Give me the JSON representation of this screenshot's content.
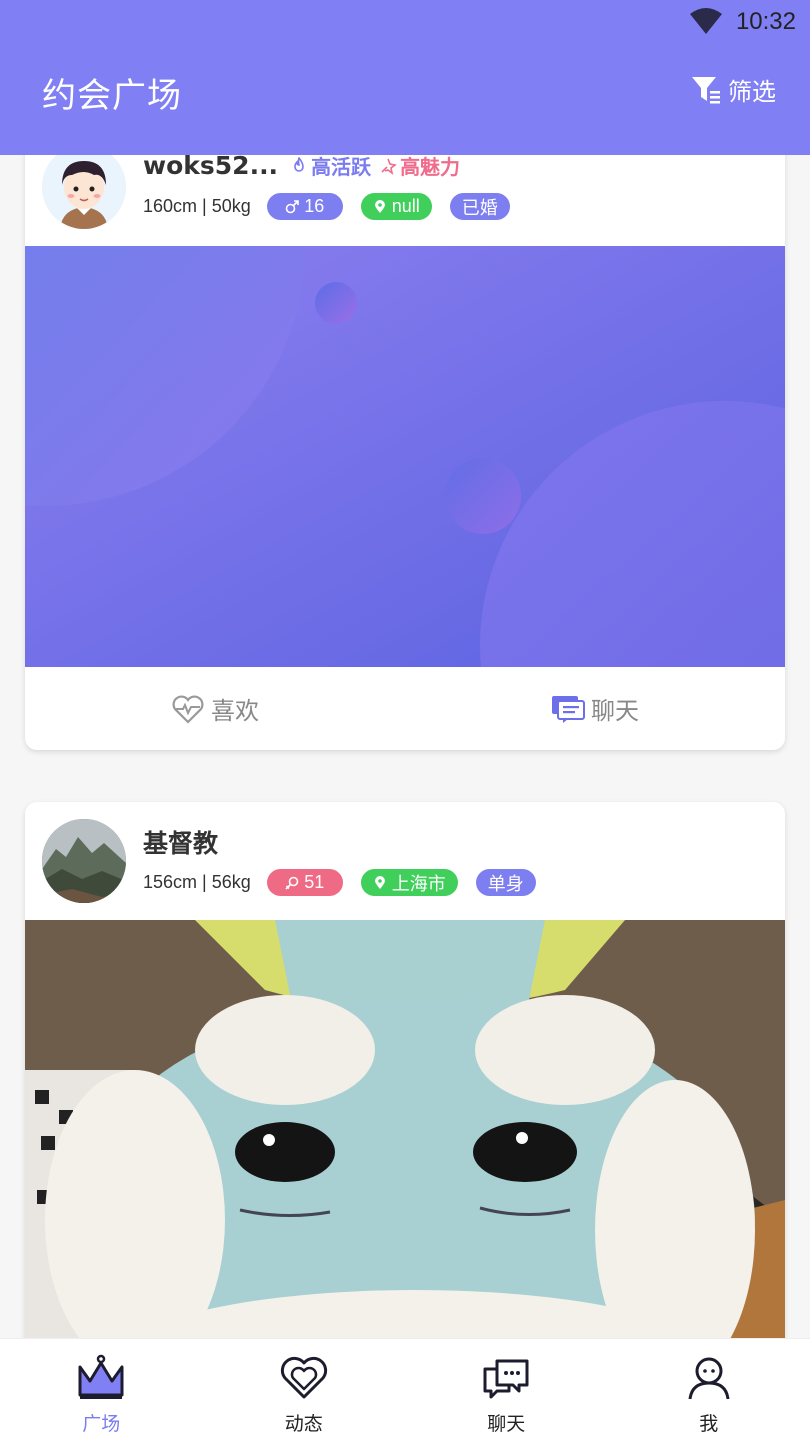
{
  "status_bar": {
    "time": "10:32"
  },
  "app_bar": {
    "title": "约会广场",
    "filter_label": "筛选"
  },
  "cards": [
    {
      "name": "woks52...",
      "badges": {
        "active": "高活跃",
        "charm": "高魅力"
      },
      "stats": "160cm | 50kg",
      "gender_age": "16",
      "city": "null",
      "marital": "已婚",
      "like_label": "喜欢",
      "chat_label": "聊天"
    },
    {
      "name": "基督教",
      "stats": "156cm | 56kg",
      "gender_age": "51",
      "city": "上海市",
      "marital": "单身"
    }
  ],
  "bottom_nav": [
    {
      "label": "广场",
      "icon": "crown-icon",
      "active": true
    },
    {
      "label": "动态",
      "icon": "heart-icon"
    },
    {
      "label": "聊天",
      "icon": "chat-bubble-icon"
    },
    {
      "label": "我",
      "icon": "person-icon"
    }
  ],
  "colors": {
    "accent": "#8080f4",
    "active_tag": "#7b7cf0",
    "charm_tag": "#f06c8c",
    "city_tag": "#3fcf5a",
    "female_tag": "#ef6a85"
  }
}
